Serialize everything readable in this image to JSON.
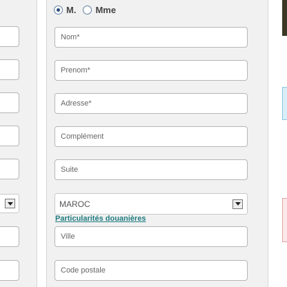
{
  "civility": {
    "options": [
      {
        "label": "M.",
        "selected": true
      },
      {
        "label": "Mme",
        "selected": false
      }
    ]
  },
  "fields": {
    "nom": {
      "placeholder": "Nom*",
      "value": ""
    },
    "prenom": {
      "placeholder": "Prenom*",
      "value": ""
    },
    "adresse": {
      "placeholder": "Adresse*",
      "value": ""
    },
    "complement": {
      "placeholder": "Complément",
      "value": ""
    },
    "suite": {
      "placeholder": "Suite",
      "value": ""
    },
    "ville": {
      "placeholder": "Ville",
      "value": ""
    },
    "code_postal": {
      "placeholder": "Code postale",
      "value": ""
    }
  },
  "country_select": {
    "value": "MAROC"
  },
  "customs_link": {
    "label": "Particularités douanières"
  },
  "colors": {
    "panel_bg": "#f1f1f1",
    "field_border": "#b5b5b5",
    "link": "#1f7a80"
  }
}
